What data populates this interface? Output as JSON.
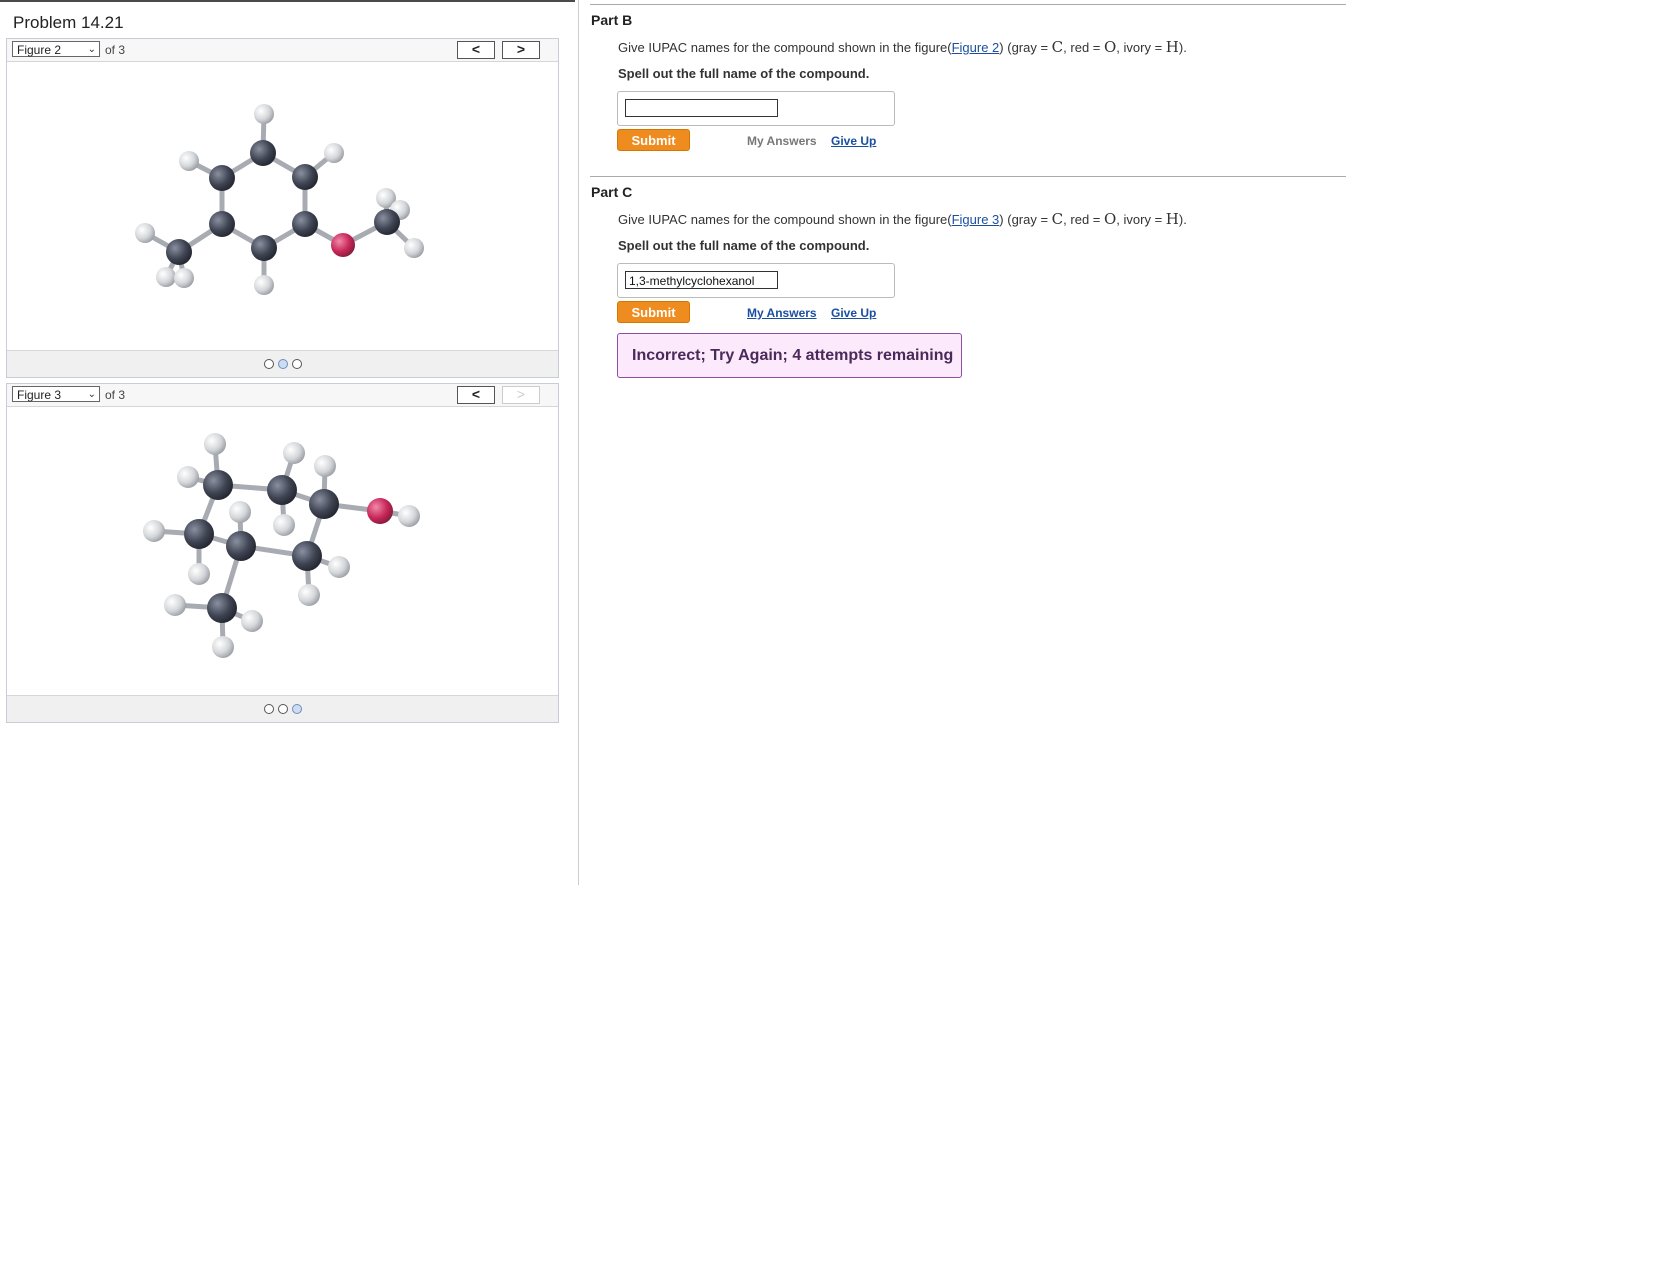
{
  "problem": {
    "title": "Problem 14.21"
  },
  "figure2": {
    "select_label": "Figure 2",
    "of_label": "of 3",
    "prev": "<",
    "next": ">",
    "dots": [
      false,
      true,
      false
    ]
  },
  "figure3": {
    "select_label": "Figure 3",
    "of_label": "of 3",
    "prev": "<",
    "next": ">",
    "dots": [
      false,
      false,
      true
    ]
  },
  "partB": {
    "title": "Part B",
    "question_prefix": "Give IUPAC names for the compound shown in the figure(",
    "figure_link": "Figure 2",
    "question_mid": ") (gray = ",
    "c": "C",
    "red": ", red = ",
    "o": "O",
    "ivory": ", ivory = ",
    "h": "H",
    "end": ").",
    "instruction": "Spell out the full name of the compound.",
    "answer_value": "",
    "submit": "Submit",
    "my_answers": "My Answers",
    "give_up": "Give Up"
  },
  "partC": {
    "title": "Part C",
    "question_prefix": "Give IUPAC names for the compound shown in the figure(",
    "figure_link": "Figure 3",
    "question_mid": ") (gray = ",
    "c": "C",
    "red": ", red = ",
    "o": "O",
    "ivory": ", ivory = ",
    "h": "H",
    "end": ").",
    "instruction": "Spell out the full name of the compound.",
    "answer_value": "1,3-methylcyclohexanol",
    "submit": "Submit",
    "my_answers": "My Answers",
    "give_up": "Give Up",
    "feedback": "Incorrect; Try Again; 4 attempts remaining"
  },
  "colors": {
    "carbon": "#3f4453",
    "oxygen": "#c8285a",
    "hydrogen": "#d9dcdf",
    "submit": "#ef8c1f",
    "feedback_bg": "#fce9fb"
  }
}
